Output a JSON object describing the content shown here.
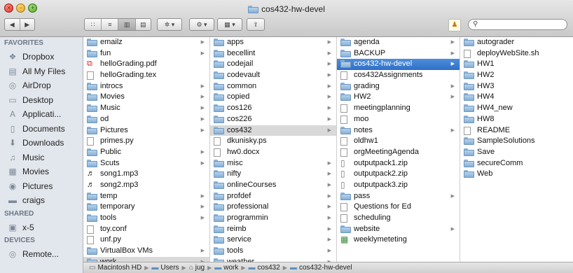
{
  "window": {
    "title": "cos432-hw-devel"
  },
  "toolbar": {
    "back": "◀",
    "forward": "▶",
    "view_icons": "∷",
    "view_list": "≡",
    "view_columns": "▥",
    "view_coverflow": "▤",
    "action": "✲ ▾",
    "arrange": "⚙ ▾",
    "grid": "▦ ▾",
    "share": "⇪",
    "search_placeholder": ""
  },
  "sidebar": {
    "favorites_label": "FAVORITES",
    "favorites": [
      {
        "label": "Dropbox",
        "icon": "dropbox-icon"
      },
      {
        "label": "All My Files",
        "icon": "all-files-icon"
      },
      {
        "label": "AirDrop",
        "icon": "airdrop-icon"
      },
      {
        "label": "Desktop",
        "icon": "desktop-icon"
      },
      {
        "label": "Applicati...",
        "icon": "applications-icon"
      },
      {
        "label": "Documents",
        "icon": "documents-icon"
      },
      {
        "label": "Downloads",
        "icon": "downloads-icon"
      },
      {
        "label": "Music",
        "icon": "music-icon"
      },
      {
        "label": "Movies",
        "icon": "movies-icon"
      },
      {
        "label": "Pictures",
        "icon": "pictures-icon"
      },
      {
        "label": "craigs",
        "icon": "home-folder-icon"
      }
    ],
    "shared_label": "SHARED",
    "shared": [
      {
        "label": "x-5",
        "icon": "computer-icon"
      }
    ],
    "devices_label": "DEVICES",
    "devices": [
      {
        "label": "Remote...",
        "icon": "remote-disc-icon"
      }
    ]
  },
  "columns": [
    {
      "items": [
        {
          "label": "emailz",
          "type": "folder",
          "arrow": true
        },
        {
          "label": "fun",
          "type": "folder",
          "arrow": true
        },
        {
          "label": "helloGrading.pdf",
          "type": "pdf",
          "arrow": false
        },
        {
          "label": "helloGrading.tex",
          "type": "doc",
          "arrow": false
        },
        {
          "label": "introcs",
          "type": "folder",
          "arrow": true
        },
        {
          "label": "Movies",
          "type": "folder",
          "arrow": true
        },
        {
          "label": "Music",
          "type": "folder",
          "arrow": true
        },
        {
          "label": "od",
          "type": "folder",
          "arrow": true
        },
        {
          "label": "Pictures",
          "type": "folder",
          "arrow": true
        },
        {
          "label": "primes.py",
          "type": "doc",
          "arrow": false
        },
        {
          "label": "Public",
          "type": "folder",
          "arrow": true
        },
        {
          "label": "Scuts",
          "type": "folder",
          "arrow": true
        },
        {
          "label": "song1.mp3",
          "type": "audio",
          "arrow": false
        },
        {
          "label": "song2.mp3",
          "type": "audio",
          "arrow": false
        },
        {
          "label": "temp",
          "type": "folder",
          "arrow": true
        },
        {
          "label": "temporary",
          "type": "folder",
          "arrow": true
        },
        {
          "label": "tools",
          "type": "folder",
          "arrow": true
        },
        {
          "label": "toy.conf",
          "type": "doc",
          "arrow": false
        },
        {
          "label": "unf.py",
          "type": "doc",
          "arrow": false
        },
        {
          "label": "VirtualBox VMs",
          "type": "folder",
          "arrow": true
        },
        {
          "label": "work",
          "type": "folder",
          "arrow": true,
          "state": "grey"
        }
      ]
    },
    {
      "items": [
        {
          "label": "apps",
          "type": "folder",
          "arrow": true
        },
        {
          "label": "becellint",
          "type": "folder",
          "arrow": true
        },
        {
          "label": "codejail",
          "type": "folder",
          "arrow": true
        },
        {
          "label": "codevault",
          "type": "folder",
          "arrow": true
        },
        {
          "label": "common",
          "type": "folder",
          "arrow": true
        },
        {
          "label": "copied",
          "type": "folder",
          "arrow": true
        },
        {
          "label": "cos126",
          "type": "folder",
          "arrow": true
        },
        {
          "label": "cos226",
          "type": "folder",
          "arrow": true
        },
        {
          "label": "cos432",
          "type": "folder",
          "arrow": true,
          "state": "grey"
        },
        {
          "label": "dkunisky.ps",
          "type": "doc",
          "arrow": false
        },
        {
          "label": "hw0.docx",
          "type": "doc",
          "arrow": false
        },
        {
          "label": "misc",
          "type": "folder",
          "arrow": true
        },
        {
          "label": "nifty",
          "type": "folder",
          "arrow": true
        },
        {
          "label": "onlineCourses",
          "type": "folder",
          "arrow": true
        },
        {
          "label": "profdef",
          "type": "folder",
          "arrow": true
        },
        {
          "label": "professional",
          "type": "folder",
          "arrow": true
        },
        {
          "label": "programmin",
          "type": "folder",
          "arrow": true
        },
        {
          "label": "reimb",
          "type": "folder",
          "arrow": true
        },
        {
          "label": "service",
          "type": "folder",
          "arrow": true
        },
        {
          "label": "tools",
          "type": "folder",
          "arrow": true
        },
        {
          "label": "weather",
          "type": "folder",
          "arrow": true
        }
      ]
    },
    {
      "items": [
        {
          "label": "agenda",
          "type": "folder",
          "arrow": true
        },
        {
          "label": "BACKUP",
          "type": "folder",
          "arrow": true
        },
        {
          "label": "cos432-hw-devel",
          "type": "folder",
          "arrow": true,
          "state": "sel"
        },
        {
          "label": "cos432Assignments",
          "type": "doc",
          "arrow": false
        },
        {
          "label": "grading",
          "type": "folder",
          "arrow": true
        },
        {
          "label": "HW2",
          "type": "folder",
          "arrow": true
        },
        {
          "label": "meetingplanning",
          "type": "doc",
          "arrow": false
        },
        {
          "label": "moo",
          "type": "doc",
          "arrow": false
        },
        {
          "label": "notes",
          "type": "folder",
          "arrow": true
        },
        {
          "label": "oldhw1",
          "type": "doc",
          "arrow": false
        },
        {
          "label": "orgMeetingAgenda",
          "type": "doc",
          "arrow": false
        },
        {
          "label": "outputpack1.zip",
          "type": "zip",
          "arrow": false
        },
        {
          "label": "outputpack2.zip",
          "type": "zip",
          "arrow": false
        },
        {
          "label": "outputpack3.zip",
          "type": "zip",
          "arrow": false
        },
        {
          "label": "pass",
          "type": "folder",
          "arrow": true
        },
        {
          "label": "Questions for Ed",
          "type": "doc",
          "arrow": false
        },
        {
          "label": "scheduling",
          "type": "doc",
          "arrow": false
        },
        {
          "label": "website",
          "type": "folder",
          "arrow": true
        },
        {
          "label": "weeklymeteting",
          "type": "sheet",
          "arrow": false
        }
      ]
    },
    {
      "items": [
        {
          "label": "autograder",
          "type": "folder",
          "arrow": false
        },
        {
          "label": "deployWebSite.sh",
          "type": "doc",
          "arrow": false
        },
        {
          "label": "HW1",
          "type": "folder",
          "arrow": false
        },
        {
          "label": "HW2",
          "type": "folder",
          "arrow": false
        },
        {
          "label": "HW3",
          "type": "folder",
          "arrow": false
        },
        {
          "label": "HW4",
          "type": "folder",
          "arrow": false
        },
        {
          "label": "HW4_new",
          "type": "folder",
          "arrow": false
        },
        {
          "label": "HW8",
          "type": "folder",
          "arrow": false
        },
        {
          "label": "README",
          "type": "doc",
          "arrow": false
        },
        {
          "label": "SampleSolutions",
          "type": "folder",
          "arrow": false
        },
        {
          "label": "Save",
          "type": "folder",
          "arrow": false
        },
        {
          "label": "secureComm",
          "type": "folder",
          "arrow": false
        },
        {
          "label": "Web",
          "type": "folder",
          "arrow": false
        }
      ]
    }
  ],
  "pathbar": [
    {
      "label": "Macintosh HD",
      "icon": "hard-drive-icon"
    },
    {
      "label": "Users",
      "icon": "folder-icon"
    },
    {
      "label": "jug",
      "icon": "home-icon"
    },
    {
      "label": "work",
      "icon": "folder-icon"
    },
    {
      "label": "cos432",
      "icon": "folder-icon"
    },
    {
      "label": "cos432-hw-devel",
      "icon": "folder-icon"
    }
  ]
}
